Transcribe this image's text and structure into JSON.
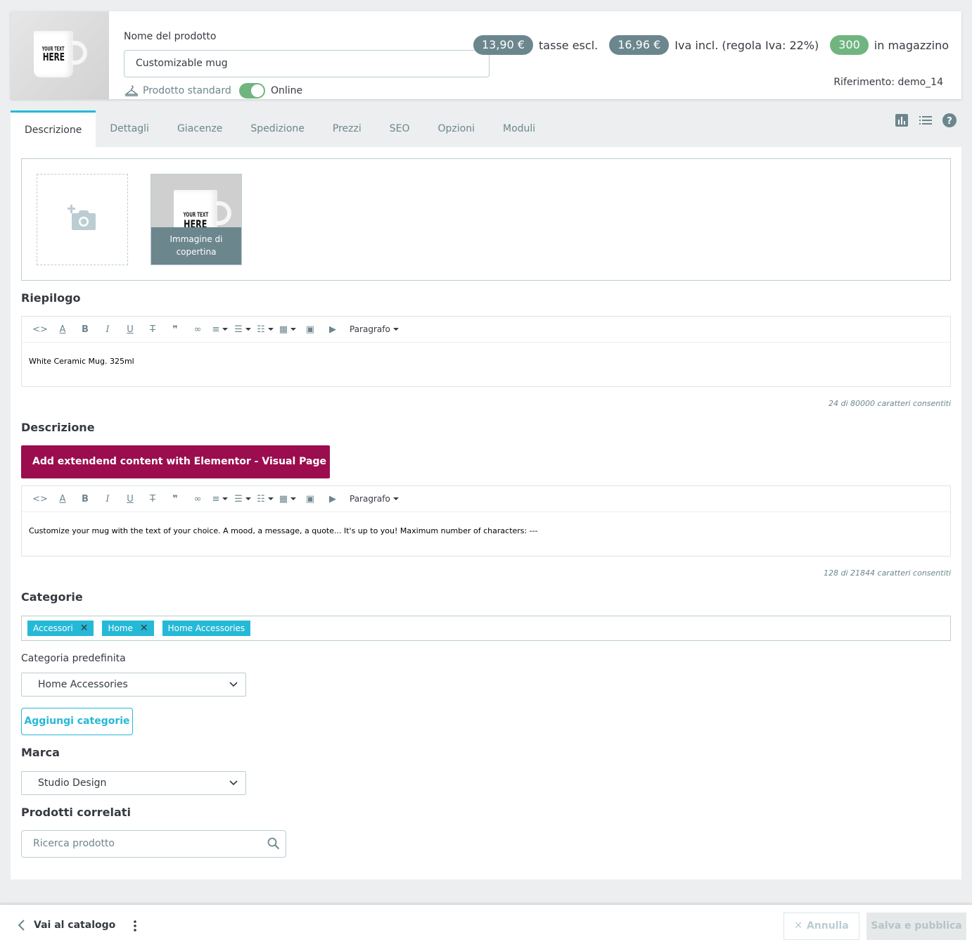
{
  "header": {
    "name_label": "Nome del prodotto",
    "name_value": "Customizable mug",
    "product_type": "Prodotto standard",
    "online_label": "Online",
    "price_excl": "13,90 €",
    "price_excl_label": "tasse escl.",
    "price_incl": "16,96 €",
    "price_incl_label": "Iva incl. (regola Iva: 22%)",
    "stock": "300",
    "stock_label": "in magazzino",
    "reference": "Riferimento: demo_14",
    "mug_text_1": "YOUR TEXT",
    "mug_text_2": "HERE"
  },
  "tabs": [
    {
      "label": "Descrizione"
    },
    {
      "label": "Dettagli"
    },
    {
      "label": "Giacenze"
    },
    {
      "label": "Spedizione"
    },
    {
      "label": "Prezzi"
    },
    {
      "label": "SEO"
    },
    {
      "label": "Opzioni"
    },
    {
      "label": "Moduli"
    }
  ],
  "images": {
    "cover_caption_1": "Immagine di",
    "cover_caption_2": "copertina"
  },
  "summary": {
    "title": "Riepilogo",
    "text": "White Ceramic Mug. 325ml",
    "counter": "24 di 80000 caratteri consentiti"
  },
  "description": {
    "title": "Descrizione",
    "elementor_button": "Add extendend content with Elementor - Visual Page Builder",
    "text": "Customize your mug with the text of your choice. A mood, a message, a quote... It's up to you! Maximum number of characters: ---",
    "counter": "128 di 21844 caratteri consentiti"
  },
  "editor": {
    "paragraph": "Paragrafo"
  },
  "categories": {
    "title": "Categorie",
    "tags": [
      {
        "label": "Accessori",
        "x": "✕"
      },
      {
        "label": "Home",
        "x": "✕"
      },
      {
        "label": "Home Accessories"
      }
    ],
    "default_label": "Categoria predefinita",
    "default_value": "Home Accessories",
    "add_button": "Aggiungi categorie"
  },
  "brand": {
    "title": "Marca",
    "value": "Studio Design"
  },
  "related": {
    "title": "Prodotti correlati",
    "placeholder": "Ricerca prodotto"
  },
  "footer": {
    "back": "Vai al catalogo",
    "cancel": "Annulla",
    "save": "Salva e pubblica"
  },
  "colors": {
    "primary": "#25b9d7",
    "elementor": "#9b0d4f",
    "grey_pill": "#6c868e",
    "green_pill": "#70b580"
  }
}
